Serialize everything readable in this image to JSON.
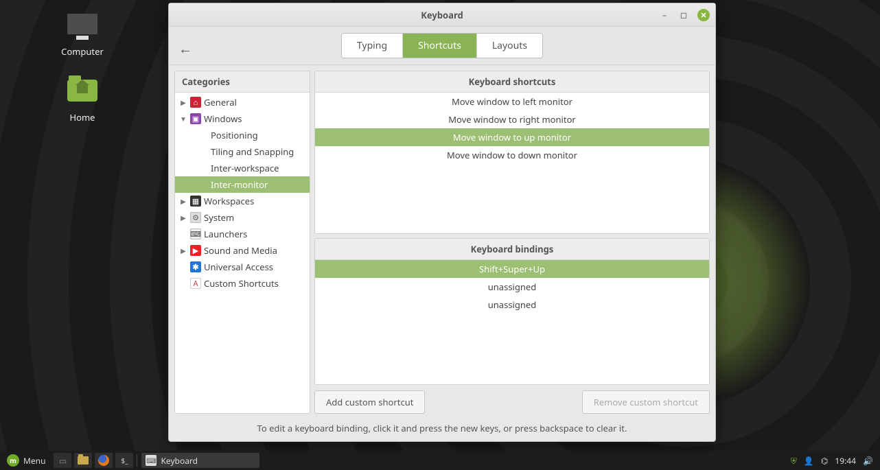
{
  "desktop": {
    "icons": {
      "computer": "Computer",
      "home": "Home"
    }
  },
  "window": {
    "title": "Keyboard",
    "tabs": {
      "typing": "Typing",
      "shortcuts": "Shortcuts",
      "layouts": "Layouts"
    },
    "active_tab": "shortcuts"
  },
  "left_panel": {
    "header": "Categories",
    "tree": {
      "general": "General",
      "windows": "Windows",
      "windows_children": {
        "positioning": "Positioning",
        "tiling": "Tiling and Snapping",
        "inter_workspace": "Inter-workspace",
        "inter_monitor": "Inter-monitor"
      },
      "workspaces": "Workspaces",
      "system": "System",
      "launchers": "Launchers",
      "sound": "Sound and Media",
      "universal": "Universal Access",
      "custom": "Custom Shortcuts"
    },
    "selected": "inter_monitor"
  },
  "shortcuts_panel": {
    "header": "Keyboard shortcuts",
    "rows": [
      "Move window to left monitor",
      "Move window to right monitor",
      "Move window to up monitor",
      "Move window to down monitor"
    ],
    "selected_index": 2
  },
  "bindings_panel": {
    "header": "Keyboard bindings",
    "rows": [
      "Shift+Super+Up",
      "unassigned",
      "unassigned"
    ],
    "selected_index": 0
  },
  "buttons": {
    "add": "Add custom shortcut",
    "remove": "Remove custom shortcut"
  },
  "hint": "To edit a keyboard binding, click it and press the new keys, or press backspace to clear it.",
  "taskbar": {
    "menu": "Menu",
    "task": "Keyboard",
    "clock": "19:44"
  }
}
